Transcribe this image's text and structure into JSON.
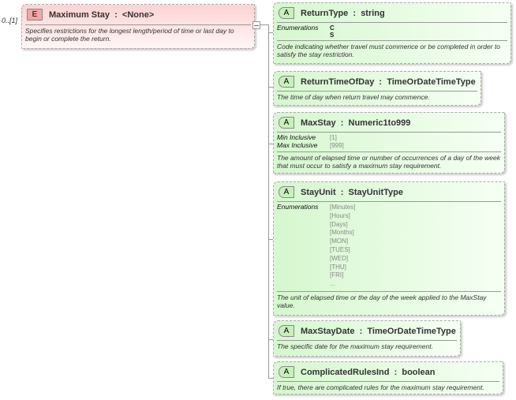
{
  "element": {
    "badge": "E",
    "title": "Maximum Stay  :  <None>",
    "cardinality": "0..[1]",
    "description": "Specifies restrictions for the  longest length/period of time or last day to begin or complete the return."
  },
  "attributes": [
    {
      "badge": "A",
      "title": "ReturnType  :  string",
      "facets": [
        {
          "label": "Enumerations",
          "values": [
            "C",
            "S"
          ],
          "bold": true
        }
      ],
      "description": "Code indicating whether travel must commence or be completed in order to satisfy the stay restriction."
    },
    {
      "badge": "A",
      "title": "ReturnTimeOfDay  :  TimeOrDateTimeType",
      "facets": [],
      "description": "The time of day when return travel may commence."
    },
    {
      "badge": "A",
      "title": "MaxStay  :  Numeric1to999",
      "facets": [
        {
          "label": "Min Inclusive",
          "values": [
            "[1]"
          ]
        },
        {
          "label": "Max Inclusive",
          "values": [
            "[999]"
          ]
        }
      ],
      "description": "The amount of elapsed time or number of occurrences of a day of the week that must occur to satisfy a maximum stay requirement."
    },
    {
      "badge": "A",
      "title": "StayUnit  :  StayUnitType",
      "facets": [
        {
          "label": "Enumerations",
          "values": [
            "[Minutes]",
            "[Hours]",
            "[Days]",
            "[Months]",
            "[MON]",
            "[TUES]",
            "[WED]",
            "[THU]",
            "[FRI]",
            "..."
          ]
        }
      ],
      "description": "The unit of elapsed time or the day of the week applied to the MaxStay value."
    },
    {
      "badge": "A",
      "title": "MaxStayDate  :  TimeOrDateTimeType",
      "facets": [],
      "description": "The specific date for the maximum stay requirement."
    },
    {
      "badge": "A",
      "title": "ComplicatedRulesInd  :  boolean",
      "facets": [],
      "description": "If true, there are complicated rules for the maximum stay requirement."
    }
  ]
}
